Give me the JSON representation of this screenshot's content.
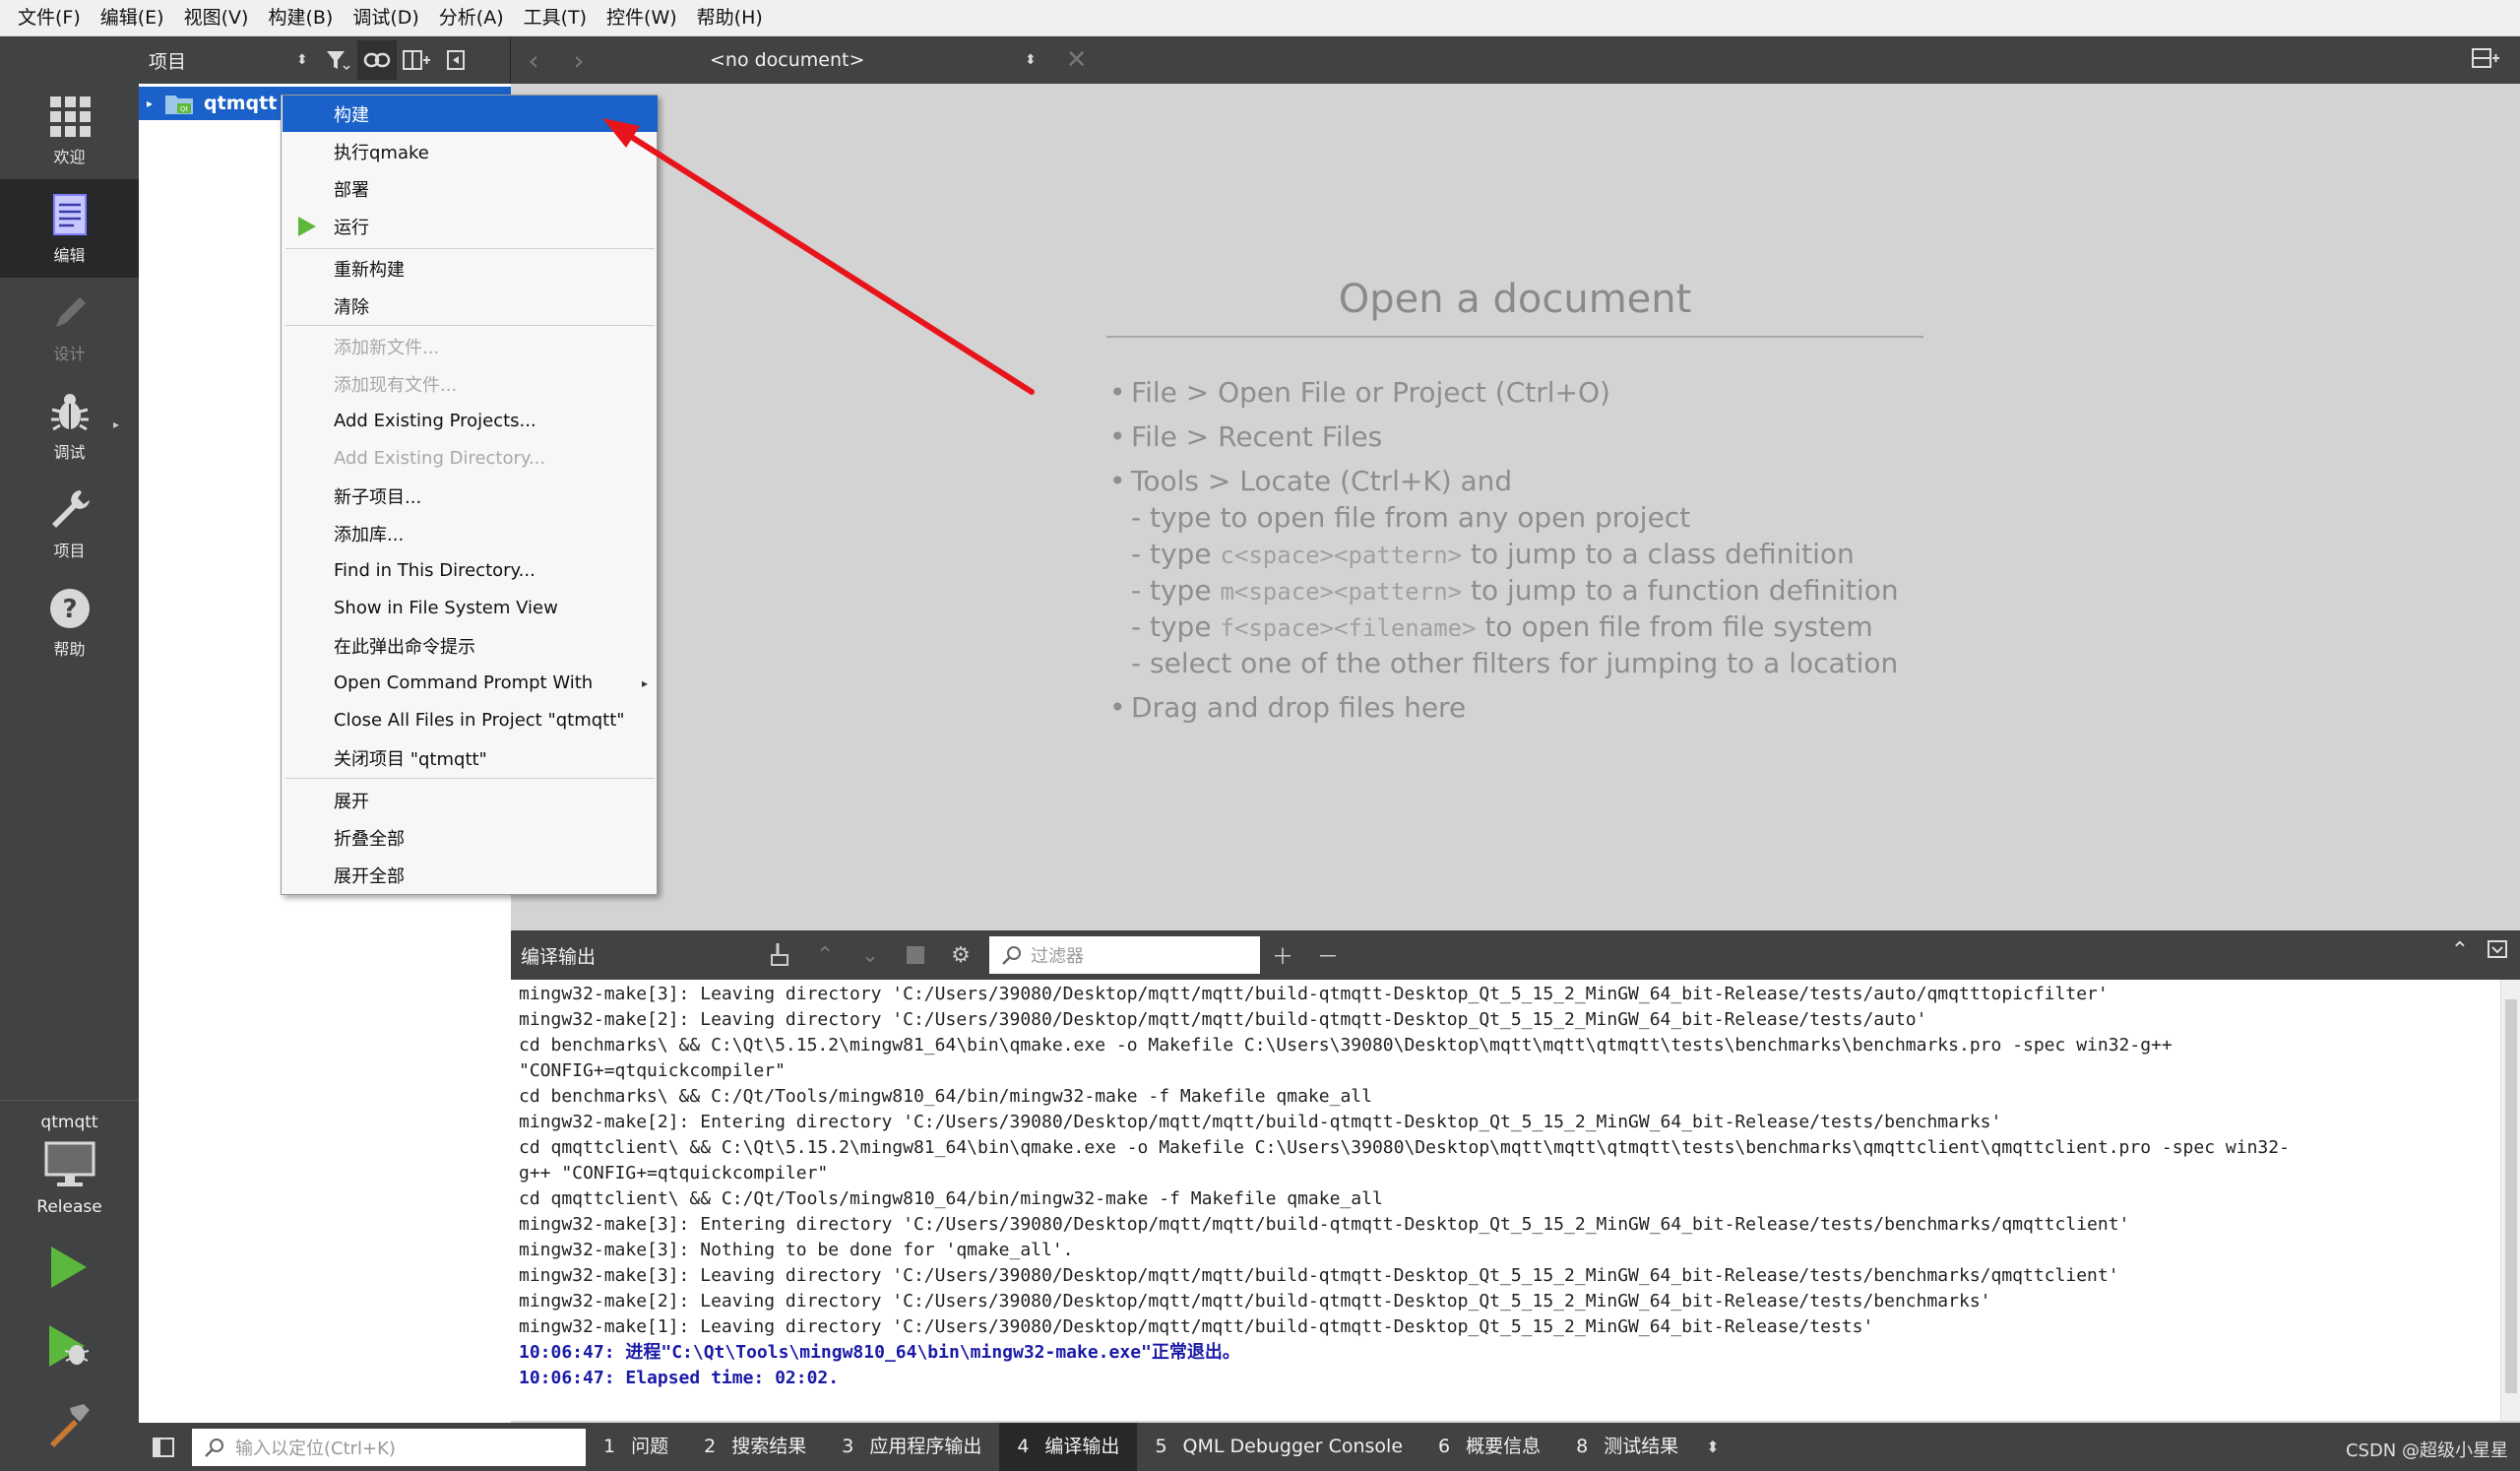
{
  "menubar": {
    "items": [
      "文件(F)",
      "编辑(E)",
      "视图(V)",
      "构建(B)",
      "调试(D)",
      "分析(A)",
      "工具(T)",
      "控件(W)",
      "帮助(H)"
    ]
  },
  "modes": [
    {
      "label": "欢迎",
      "icon": "grid-icon"
    },
    {
      "label": "编辑",
      "icon": "edit-document-icon",
      "active": true
    },
    {
      "label": "设计",
      "icon": "pencil-icon",
      "disabled": true
    },
    {
      "label": "调试",
      "icon": "bug-icon"
    },
    {
      "label": "项目",
      "icon": "wrench-icon"
    },
    {
      "label": "帮助",
      "icon": "help-icon"
    }
  ],
  "kit": {
    "project": "qtmqtt",
    "build_config": "Release",
    "icon": "monitor-icon"
  },
  "project_pane": {
    "view_selector": "项目",
    "root_node": "qtmqtt"
  },
  "editor_toolbar": {
    "document": "<no document>"
  },
  "welcome": {
    "title": "Open a document",
    "hints": {
      "h1": "File > Open File or Project (Ctrl+O)",
      "h2": "File > Recent Files",
      "h3": "Tools > Locate (Ctrl+K) and",
      "s1": "- type to open file from any open project",
      "s2_pre": "- type ",
      "s2_code": "c<space><pattern>",
      "s2_post": " to jump to a class definition",
      "s3_pre": "- type ",
      "s3_code": "m<space><pattern>",
      "s3_post": " to jump to a function definition",
      "s4_pre": "- type ",
      "s4_code": "f<space><filename>",
      "s4_post": " to open file from file system",
      "s5": "- select one of the other filters for jumping to a location",
      "h4": "Drag and drop files here"
    }
  },
  "context_menu": {
    "items": [
      {
        "label": "构建",
        "highlighted": true
      },
      {
        "label": "执行qmake"
      },
      {
        "label": "部署"
      },
      {
        "label": "运行",
        "icon": "run-icon"
      },
      {
        "label": "重新构建"
      },
      {
        "label": "清除"
      },
      {
        "label": "添加新文件...",
        "disabled": true
      },
      {
        "label": "添加现有文件...",
        "disabled": true
      },
      {
        "label": "Add Existing Projects..."
      },
      {
        "label": "Add Existing Directory...",
        "disabled": true
      },
      {
        "label": "新子项目..."
      },
      {
        "label": "添加库..."
      },
      {
        "label": "Find in This Directory..."
      },
      {
        "label": "Show in File System View"
      },
      {
        "label": "在此弹出命令提示"
      },
      {
        "label": "Open Command Prompt With",
        "submenu": true
      },
      {
        "label": "Close All Files in Project \"qtmqtt\""
      },
      {
        "label": "关闭项目 \"qtmqtt\""
      },
      {
        "label": "展开"
      },
      {
        "label": "折叠全部"
      },
      {
        "label": "展开全部"
      }
    ]
  },
  "output_pane": {
    "title": "编译输出",
    "filter_placeholder": "过滤器",
    "lines": [
      "mingw32-make[3]: Leaving directory 'C:/Users/39080/Desktop/mqtt/mqtt/build-qtmqtt-Desktop_Qt_5_15_2_MinGW_64_bit-Release/tests/auto/qmqtttopicfilter'",
      "mingw32-make[2]: Leaving directory 'C:/Users/39080/Desktop/mqtt/mqtt/build-qtmqtt-Desktop_Qt_5_15_2_MinGW_64_bit-Release/tests/auto'",
      "cd benchmarks\\ && C:\\Qt\\5.15.2\\mingw81_64\\bin\\qmake.exe -o Makefile C:\\Users\\39080\\Desktop\\mqtt\\mqtt\\qtmqtt\\tests\\benchmarks\\benchmarks.pro -spec win32-g++",
      "\"CONFIG+=qtquickcompiler\"",
      "cd benchmarks\\ && C:/Qt/Tools/mingw810_64/bin/mingw32-make -f Makefile qmake_all",
      "mingw32-make[2]: Entering directory 'C:/Users/39080/Desktop/mqtt/mqtt/build-qtmqtt-Desktop_Qt_5_15_2_MinGW_64_bit-Release/tests/benchmarks'",
      "cd qmqttclient\\ && C:\\Qt\\5.15.2\\mingw81_64\\bin\\qmake.exe -o Makefile C:\\Users\\39080\\Desktop\\mqtt\\mqtt\\qtmqtt\\tests\\benchmarks\\qmqttclient\\qmqttclient.pro -spec win32-",
      "g++ \"CONFIG+=qtquickcompiler\"",
      "cd qmqttclient\\ && C:/Qt/Tools/mingw810_64/bin/mingw32-make -f Makefile qmake_all",
      "mingw32-make[3]: Entering directory 'C:/Users/39080/Desktop/mqtt/mqtt/build-qtmqtt-Desktop_Qt_5_15_2_MinGW_64_bit-Release/tests/benchmarks/qmqttclient'",
      "mingw32-make[3]: Nothing to be done for 'qmake_all'.",
      "mingw32-make[3]: Leaving directory 'C:/Users/39080/Desktop/mqtt/mqtt/build-qtmqtt-Desktop_Qt_5_15_2_MinGW_64_bit-Release/tests/benchmarks/qmqttclient'",
      "mingw32-make[2]: Leaving directory 'C:/Users/39080/Desktop/mqtt/mqtt/build-qtmqtt-Desktop_Qt_5_15_2_MinGW_64_bit-Release/tests/benchmarks'",
      "mingw32-make[1]: Leaving directory 'C:/Users/39080/Desktop/mqtt/mqtt/build-qtmqtt-Desktop_Qt_5_15_2_MinGW_64_bit-Release/tests'"
    ],
    "status_lines": [
      "10:06:47: 进程\"C:\\Qt\\Tools\\mingw810_64\\bin\\mingw32-make.exe\"正常退出。",
      "10:06:47: Elapsed time: 02:02."
    ]
  },
  "statusbar": {
    "locator_placeholder": "输入以定位(Ctrl+K)",
    "tabs": [
      {
        "num": "1",
        "label": "问题"
      },
      {
        "num": "2",
        "label": "搜索结果"
      },
      {
        "num": "3",
        "label": "应用程序输出"
      },
      {
        "num": "4",
        "label": "编译输出",
        "active": true
      },
      {
        "num": "5",
        "label": "QML Debugger Console"
      },
      {
        "num": "6",
        "label": "概要信息"
      },
      {
        "num": "8",
        "label": "测试结果"
      }
    ],
    "watermark": "CSDN @超级小星星"
  },
  "colors": {
    "selection": "#1a62c9",
    "annotation_arrow": "#e8141b",
    "run_green": "#5cb83c",
    "sidebar_bg": "#404244"
  }
}
